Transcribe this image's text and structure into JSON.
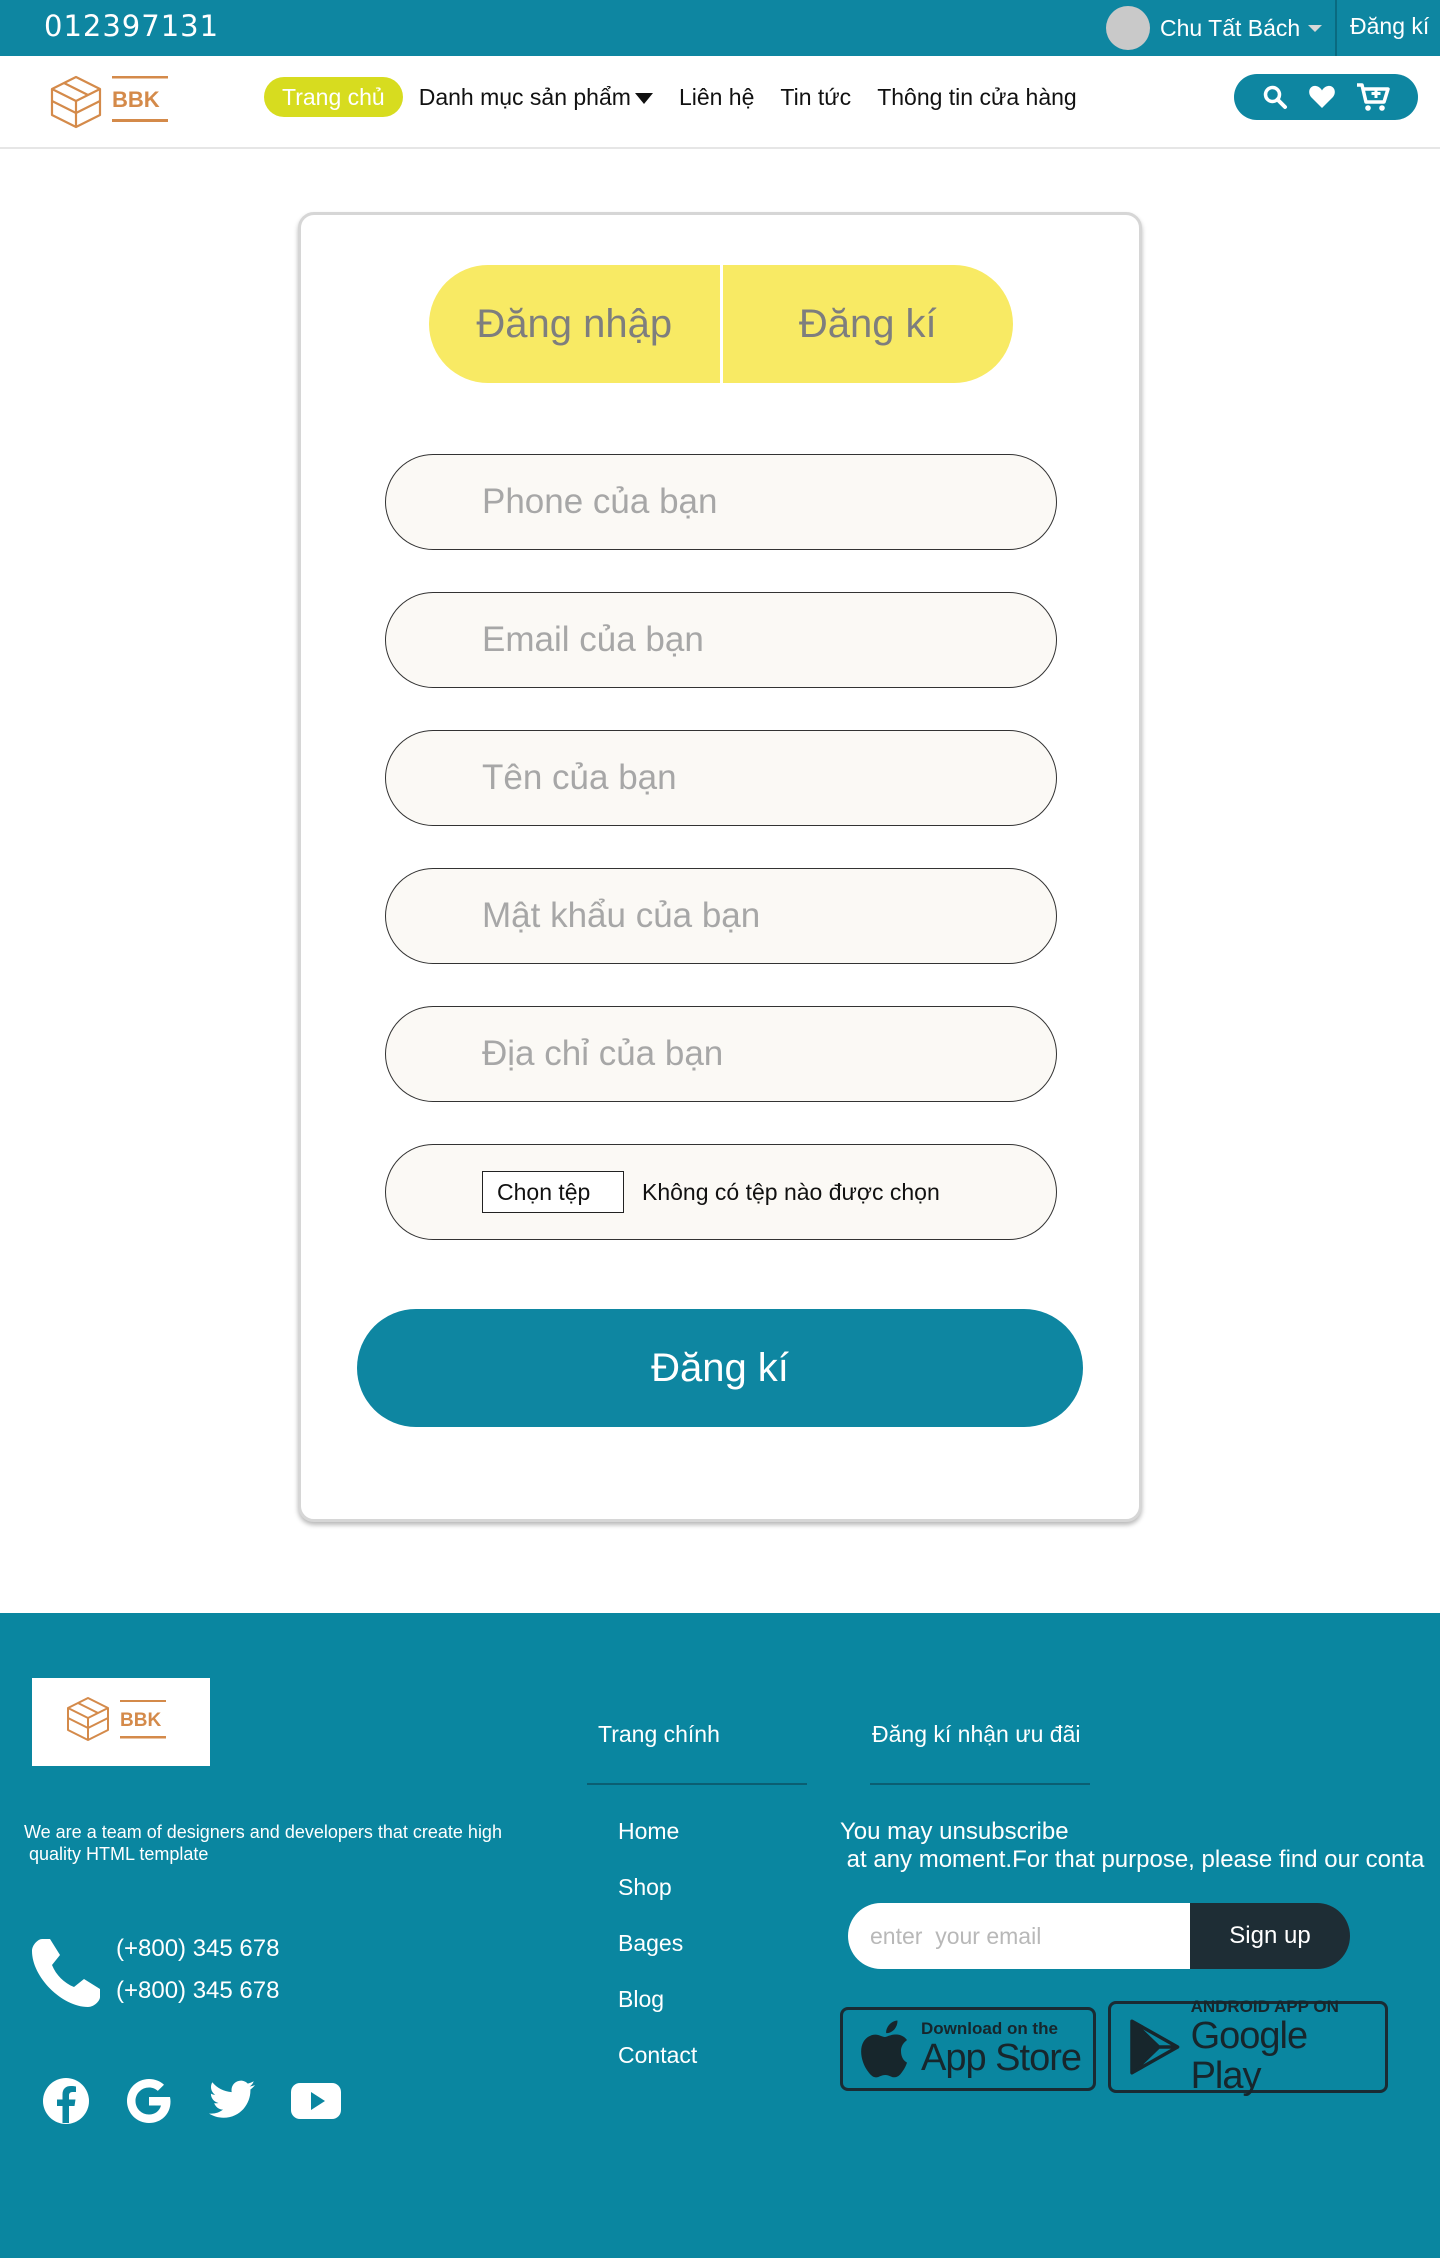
{
  "topbar": {
    "phone": "012397131",
    "user_name": "Chu Tất Bách",
    "register_link": "Đăng kí"
  },
  "nav": {
    "logo_text": "BBK",
    "items": [
      "Trang chủ",
      "Danh mục sản phẩm",
      "Liên hệ",
      "Tin tức",
      "Thông tin cửa hàng"
    ],
    "icons": [
      "search-icon",
      "heart-icon",
      "cart-icon"
    ]
  },
  "form": {
    "tab_login": "Đăng nhập",
    "tab_register": "Đăng kí",
    "phone_placeholder": "Phone của bạn",
    "email_placeholder": "Email của bạn",
    "name_placeholder": "Tên của bạn",
    "password_placeholder": "Mật khẩu của bạn",
    "address_placeholder": "Địa chỉ của bạn",
    "file_button": "Chọn tệp",
    "file_status": "Không có tệp nào được chọn",
    "submit": "Đăng kí"
  },
  "footer": {
    "logo_text": "BBK",
    "about": "We are a team of designers and developers that create high\n quality HTML template",
    "tel1": "(+800) 345 678",
    "tel2": "(+800) 345 678",
    "socials": [
      "facebook-icon",
      "google-icon",
      "twitter-icon",
      "youtube-icon"
    ],
    "col_main_title": "Trang chính",
    "links": [
      "Home",
      "Shop",
      "Bages",
      "Blog",
      "Contact"
    ],
    "col_promo_title": "Đăng kí nhận ưu đãi",
    "promo_text": "You may unsubscribe\n at any moment.For that purpose, please find our conta",
    "email_placeholder": "enter  your email",
    "signup": "Sign up",
    "appstore_small": "Download on the",
    "appstore_big": "App Store",
    "googleplay_small": "ANDROID APP ON",
    "googleplay_big": "Google Play"
  },
  "colors": {
    "primary": "#0e86a1",
    "accent_yellow": "#f8ea64",
    "active_nav": "#d7dc1f",
    "logo_orange": "#d48a4a"
  }
}
